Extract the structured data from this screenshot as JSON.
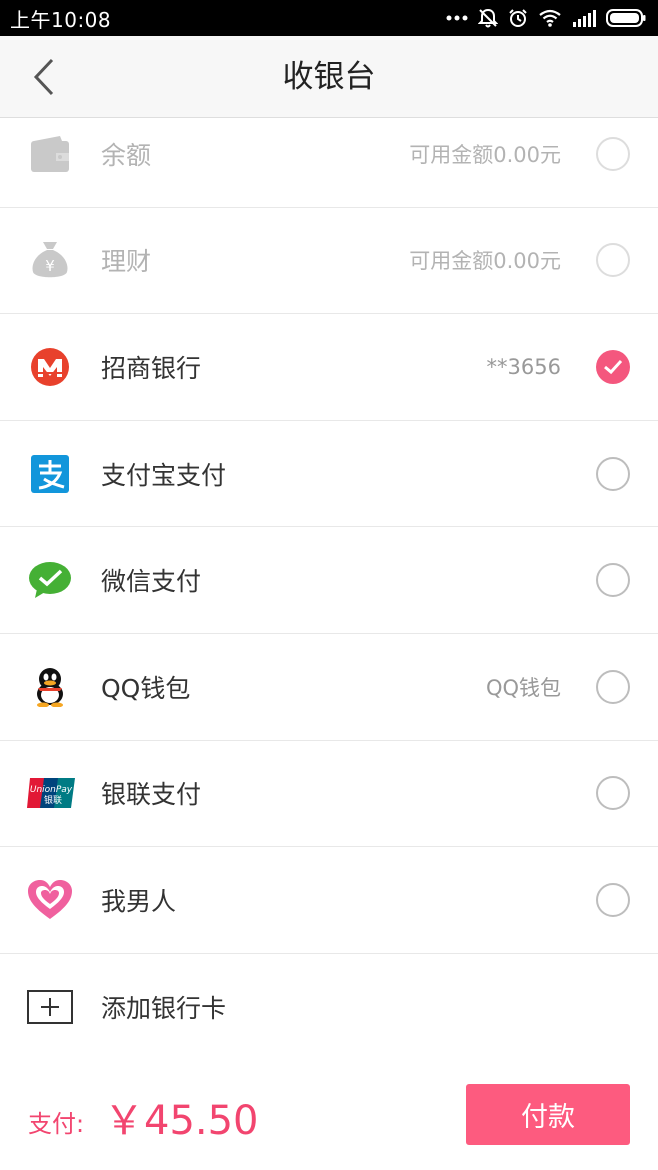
{
  "status_bar": {
    "time": "上午10:08"
  },
  "nav": {
    "title": "收银台"
  },
  "methods": [
    {
      "label": "余额",
      "info": "可用金额0.00元",
      "icon": "wallet-icon",
      "checked": false,
      "disabled": true
    },
    {
      "label": "理财",
      "info": "可用金额0.00元",
      "icon": "money-bag-icon",
      "checked": false,
      "disabled": true
    },
    {
      "label": "招商银行",
      "info": "**3656",
      "icon": "cmb-bank-icon",
      "checked": true,
      "disabled": false
    },
    {
      "label": "支付宝支付",
      "info": "",
      "icon": "alipay-icon",
      "checked": false,
      "disabled": false
    },
    {
      "label": "微信支付",
      "info": "",
      "icon": "wechat-pay-icon",
      "checked": false,
      "disabled": false
    },
    {
      "label": "QQ钱包",
      "info": "QQ钱包",
      "icon": "qq-penguin-icon",
      "checked": false,
      "disabled": false
    },
    {
      "label": "银联支付",
      "info": "",
      "icon": "unionpay-icon",
      "checked": false,
      "disabled": false
    },
    {
      "label": "我男人",
      "info": "",
      "icon": "heart-icon",
      "checked": false,
      "disabled": false
    },
    {
      "label": "添加银行卡",
      "icon": "plus-icon"
    }
  ],
  "unionpay_logo": {
    "text1": "UnionPay",
    "text2": "银联"
  },
  "footer": {
    "pay_label": "支付:",
    "amount": "￥45.50",
    "button_label": "付款"
  },
  "colors": {
    "accent": "#f4577e",
    "price": "#f2456f",
    "button": "#fd5b7f"
  }
}
